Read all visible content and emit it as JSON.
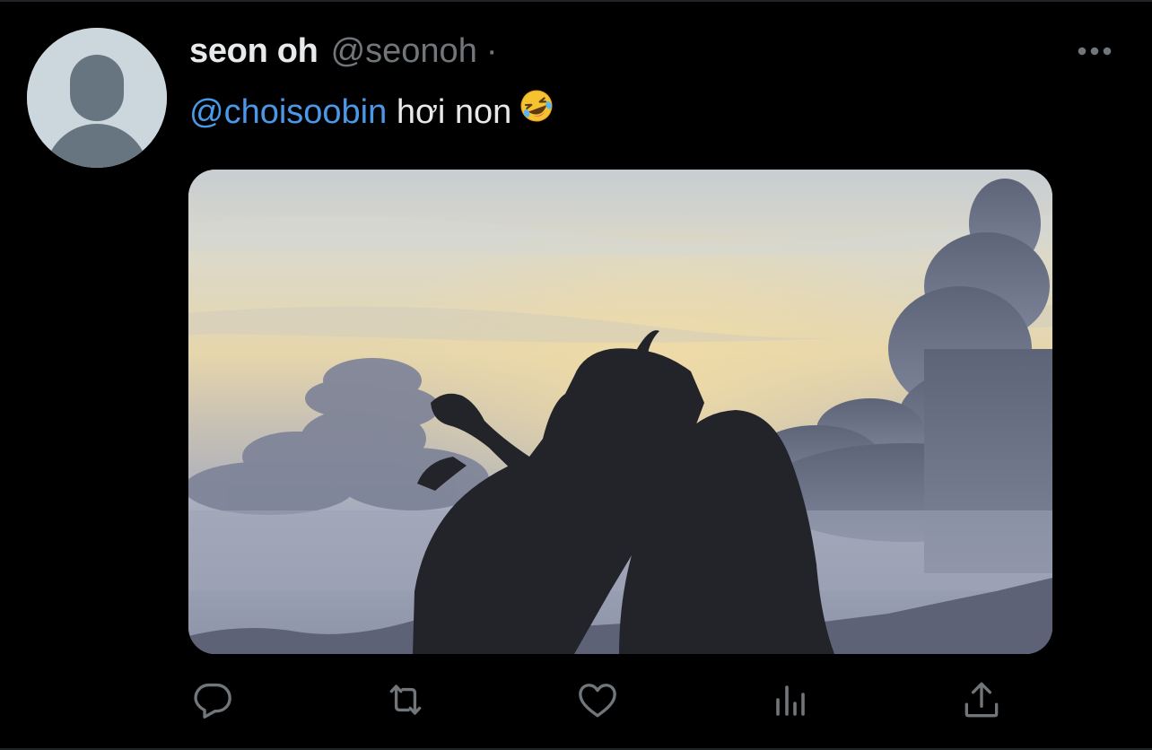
{
  "tweet": {
    "display_name": "seon oh",
    "handle": "@seonoh",
    "separator": "·",
    "text_mention": "@choisoobin",
    "text_body": " hơi non",
    "emoji": "rolling-on-the-floor-laughing"
  },
  "actions": {
    "reply": "reply-icon",
    "retweet": "retweet-icon",
    "like": "heart-icon",
    "views": "analytics-icon",
    "share": "share-icon"
  },
  "colors": {
    "background": "#000000",
    "text": "#e7e9ea",
    "secondary": "#71767b",
    "accent": "#4a99e9"
  }
}
